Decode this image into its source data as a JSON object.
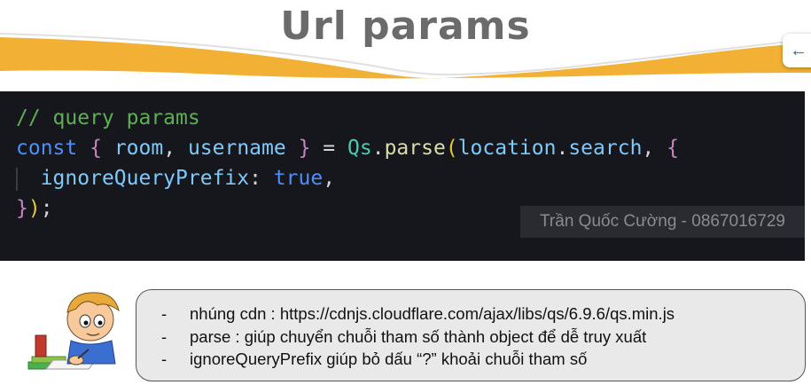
{
  "slide": {
    "title": "Url params"
  },
  "nav": {
    "back_icon": "arrow-left-icon"
  },
  "code": {
    "comment": "// query params",
    "kw_const": "const",
    "brace_open": "{",
    "var_room": "room",
    "comma1": ",",
    "var_username": "username",
    "brace_close": "}",
    "equals": "=",
    "obj_qs": "Qs",
    "dot1": ".",
    "fn_parse": "parse",
    "paren_open": "(",
    "obj_location": "location",
    "dot2": ".",
    "prop_search": "search",
    "comma2": ",",
    "brace_open2": "{",
    "prop_ignore": "ignoreQueryPrefix",
    "colon": ":",
    "val_true": "true",
    "comma3": ",",
    "close_brace2": "}",
    "close_paren": ")",
    "semicolon": ";"
  },
  "watermark": "Trần Quốc Cường - 0867016729",
  "notes": {
    "bullet": "-",
    "items": [
      "nhúng cdn : https://cdnjs.cloudflare.com/ajax/libs/qs/6.9.6/qs.min.js",
      "parse : giúp chuyển chuỗi tham số thành object để dễ truy xuất",
      "ignoreQueryPrefix giúp bỏ dấu “?” khoải chuỗi tham số"
    ]
  },
  "colors": {
    "banner_orange": "#f2b134",
    "code_bg": "#16171d",
    "notes_bg": "#e9e9e9"
  }
}
